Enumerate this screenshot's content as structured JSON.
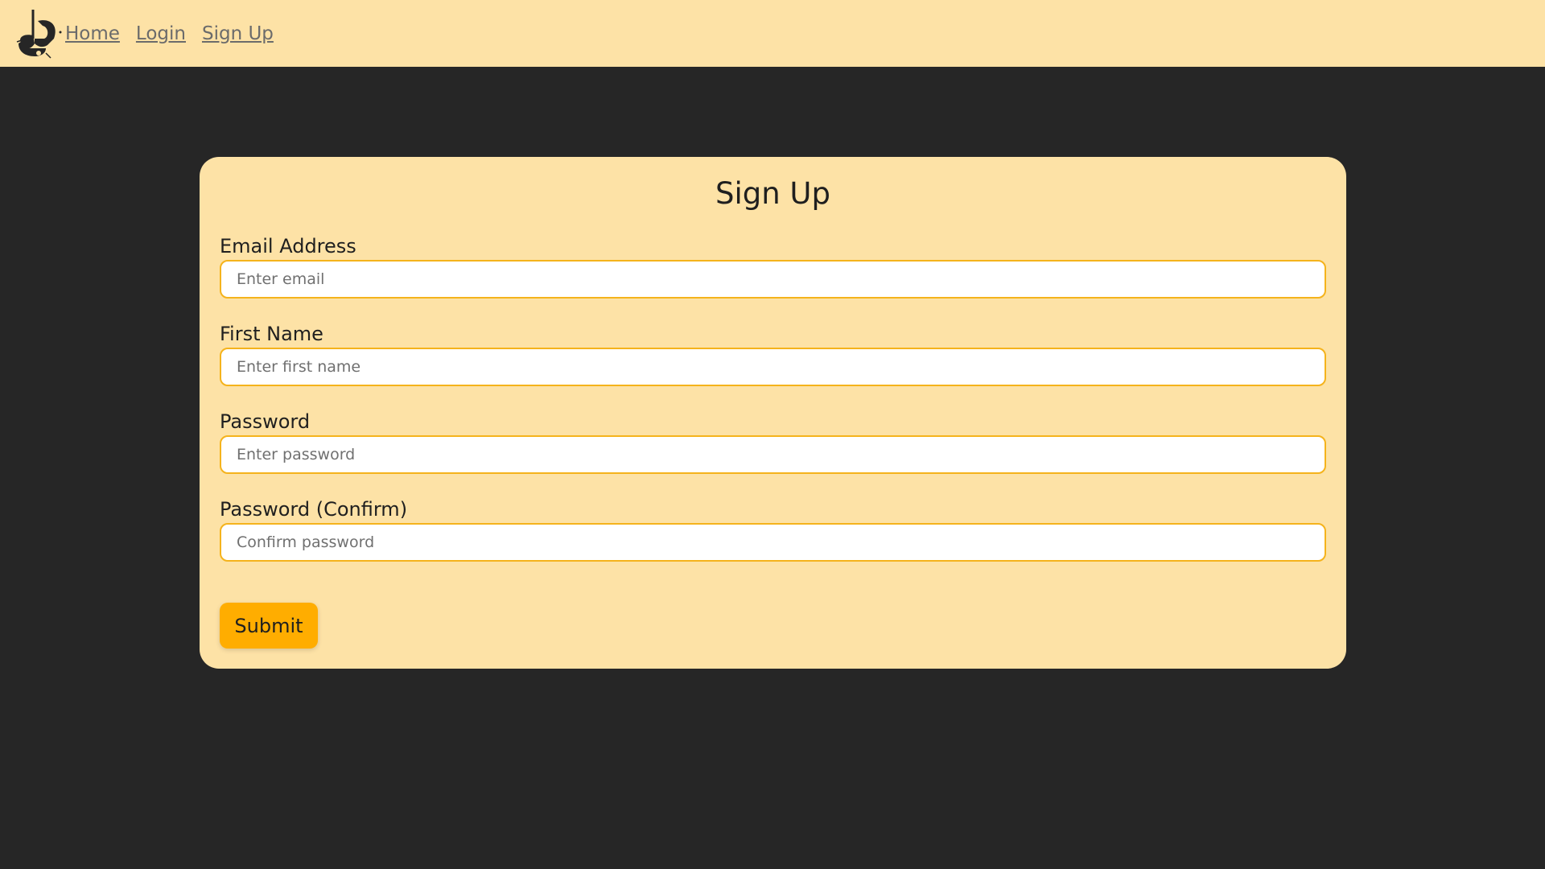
{
  "navbar": {
    "logo_icon": "python-logo-icon",
    "links": [
      {
        "label": "Home"
      },
      {
        "label": "Login"
      },
      {
        "label": "Sign Up"
      }
    ]
  },
  "form": {
    "title": "Sign Up",
    "fields": [
      {
        "label": "Email Address",
        "placeholder": "Enter email",
        "value": ""
      },
      {
        "label": "First Name",
        "placeholder": "Enter first name",
        "value": ""
      },
      {
        "label": "Password",
        "placeholder": "Enter password",
        "value": ""
      },
      {
        "label": "Password (Confirm)",
        "placeholder": "Confirm password",
        "value": ""
      }
    ],
    "submit_label": "Submit"
  },
  "colors": {
    "background": "#262626",
    "panel": "#fde2a6",
    "accent": "#ffad00",
    "input_border": "#f5b31c"
  }
}
